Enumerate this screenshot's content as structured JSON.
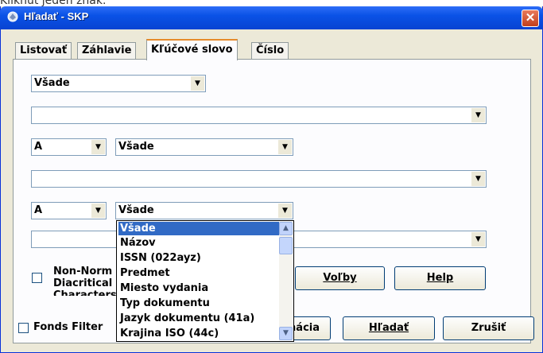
{
  "top_text": "Kliknúť jeden znak.",
  "window": {
    "title": "Hľadať - SKP",
    "close_glyph": "✕"
  },
  "tabs": [
    {
      "label": "Listovať"
    },
    {
      "label": "Záhlavie"
    },
    {
      "label": "Kľúčové slovo",
      "active": true
    },
    {
      "label": "Číslo"
    }
  ],
  "search": {
    "field1": "Všade",
    "term1": "",
    "op2": "A",
    "field2": "Všade",
    "term2": "",
    "op3": "A",
    "field3": "Všade",
    "term3": ""
  },
  "dropdown": {
    "items": [
      "Všade",
      "Názov",
      "ISSN (022ayz)",
      "Predmet",
      "Miesto vydania",
      "Typ dokumentu",
      "Jazyk dokumentu (41a)",
      "Krajina ISO (44c)"
    ],
    "selected": "Všade"
  },
  "options": {
    "non_norm_label": "Non-Norm",
    "diacritical_label": "Diacritical",
    "characters_label": "Characters",
    "fonds_filter_label": "Fonds Filter"
  },
  "buttons": {
    "volby": "Voľby",
    "help": "Help",
    "kombinacia": "Kombinácia",
    "hladat": "Hľadať",
    "zrusit": "Zrušiť"
  },
  "icons": {
    "dropdown_arrow": "▼",
    "scroll_up": "▲",
    "scroll_down": "▼"
  }
}
